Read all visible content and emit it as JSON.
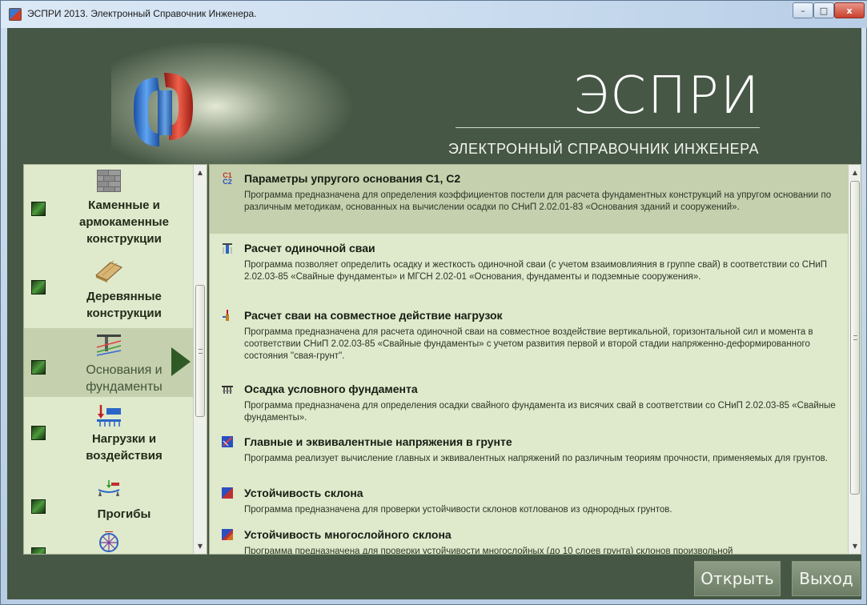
{
  "window": {
    "title": "ЭСПРИ 2013. Электронный Справочник Инженера.",
    "controls": {
      "minimize": "–",
      "maximize": "□",
      "close": "x"
    }
  },
  "header": {
    "logo_title": "ЭСПРИ",
    "logo_subtitle": "ЭЛЕКТРОННЫЙ СПРАВОЧНИК ИНЖЕНЕРА"
  },
  "sidebar": {
    "items": [
      {
        "label": "Каменные и армокаменные конструкции",
        "icon": "brick-wall-icon",
        "active": false
      },
      {
        "label": "Деревянные конструкции",
        "icon": "wood-planks-icon",
        "active": false
      },
      {
        "label": "Основания и фундаменты",
        "icon": "foundation-icon",
        "active": true
      },
      {
        "label": "Нагрузки и воздействия",
        "icon": "loads-icon",
        "active": false
      },
      {
        "label": "Прогибы",
        "icon": "deflection-icon",
        "active": false
      },
      {
        "label": "",
        "icon": "truss-icon",
        "active": false
      }
    ],
    "scrollbar": {
      "up": "▲",
      "down": "▼"
    }
  },
  "list": {
    "entries": [
      {
        "icon": "c1c2-icon",
        "title": "Параметры упругого основания С1, С2",
        "description": "Программа предназначена для определения коэффициентов постели для расчета фундаментных конструкций на упругом основании по различным методикам, основанных на вычислении осадки по СНиП 2.02.01-83 «Основания зданий и сооружений».",
        "selected": true
      },
      {
        "icon": "pile-icon",
        "title": "Расчет одиночной сваи",
        "description": "Программа позволяет определить осадку и жесткость одиночной сваи (с учетом взаимовлияния в группе свай) в соответствии со СНиП 2.02.03-85 «Свайные фундаменты» и МГСН 2.02-01 «Основания, фундаменты и подземные сооружения».",
        "selected": false
      },
      {
        "icon": "pile-load-icon",
        "title": "Расчет сваи на совместное действие нагрузок",
        "description": "Программа предназначена для расчета одиночной сваи на совместное воздействие вертикальной, горизонтальной сил и момента в соответствии СНиП 2.02.03-85 «Свайные фундаменты» с учетом развития первой и второй стадии напряженно-деформированного состояния \"свая-грунт\".",
        "selected": false
      },
      {
        "icon": "conditional-foundation-icon",
        "title": "Осадка условного фундамента",
        "description": "Программа предназначена для определения осадки свайного фундамента из висячих свай в соответствии со СНиП 2.02.03-85 «Свайные фундаменты».",
        "selected": false
      },
      {
        "icon": "soil-stress-icon",
        "title": "Главные и эквивалентные напряжения в грунте",
        "description": "Программа реализует вычисление главных и эквивалентных напряжений по различным теориям прочности, применяемых для грунтов.",
        "selected": false
      },
      {
        "icon": "slope-icon",
        "title": "Устойчивость склона",
        "description": "Программа предназначена для проверки устойчивости склонов котлованов из однородных грунтов.",
        "selected": false
      },
      {
        "icon": "multilayer-slope-icon",
        "title": "Устойчивость многослойного склона",
        "description": "Программа предназначена для проверки устойчивости многослойных (до 10 слоев грунта) склонов произвольной",
        "selected": false
      }
    ]
  },
  "buttons": {
    "open": "Открыть",
    "exit": "Выход"
  }
}
